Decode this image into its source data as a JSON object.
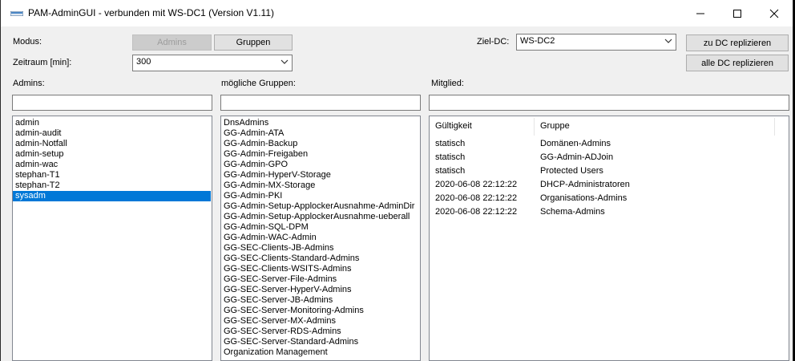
{
  "window": {
    "title": "PAM-AdminGUI - verbunden mit WS-DC1 (Version V1.11)"
  },
  "labels": {
    "modus": "Modus:",
    "zeitraum": "Zeitraum [min]:",
    "ziel_dc": "Ziel-DC:",
    "admins": "Admins:",
    "gruppen": "mögliche Gruppen:",
    "mitglied": "Mitglied:"
  },
  "buttons": {
    "admins": "Admins",
    "gruppen": "Gruppen",
    "zu_dc": "zu DC replizieren",
    "alle_dc": "alle DC replizieren"
  },
  "zeitraum": {
    "value": "300"
  },
  "ziel_dc": {
    "value": "WS-DC2"
  },
  "admins_list": [
    "admin",
    "admin-audit",
    "admin-Notfall",
    "admin-setup",
    "admin-wac",
    "stephan-T1",
    "stephan-T2",
    "sysadm"
  ],
  "admins_selected": "sysadm",
  "groups_list": [
    "DnsAdmins",
    "GG-Admin-ATA",
    "GG-Admin-Backup",
    "GG-Admin-Freigaben",
    "GG-Admin-GPO",
    "GG-Admin-HyperV-Storage",
    "GG-Admin-MX-Storage",
    "GG-Admin-PKI",
    "GG-Admin-Setup-ApplockerAusnahme-AdminDir",
    "GG-Admin-Setup-ApplockerAusnahme-ueberall",
    "GG-Admin-SQL-DPM",
    "GG-Admin-WAC-Admin",
    "GG-SEC-Clients-JB-Admins",
    "GG-SEC-Clients-Standard-Admins",
    "GG-SEC-Clients-WSITS-Admins",
    "GG-SEC-Server-File-Admins",
    "GG-SEC-Server-HyperV-Admins",
    "GG-SEC-Server-JB-Admins",
    "GG-SEC-Server-Monitoring-Admins",
    "GG-SEC-Server-MX-Admins",
    "GG-SEC-Server-RDS-Admins",
    "GG-SEC-Server-Standard-Admins",
    "Organization Management"
  ],
  "member_columns": [
    "Gültigkeit",
    "Gruppe"
  ],
  "member_rows": [
    {
      "gueltigkeit": "statisch",
      "gruppe": "Domänen-Admins"
    },
    {
      "gueltigkeit": "statisch",
      "gruppe": "GG-Admin-ADJoin"
    },
    {
      "gueltigkeit": "statisch",
      "gruppe": "Protected Users"
    },
    {
      "gueltigkeit": "2020-06-08 22:12:22",
      "gruppe": "DHCP-Administratoren"
    },
    {
      "gueltigkeit": "2020-06-08 22:12:22",
      "gruppe": "Organisations-Admins"
    },
    {
      "gueltigkeit": "2020-06-08 22:12:22",
      "gruppe": "Schema-Admins"
    }
  ],
  "colors": {
    "selection": "#0078d7",
    "window_bg": "#f0f0f0"
  }
}
